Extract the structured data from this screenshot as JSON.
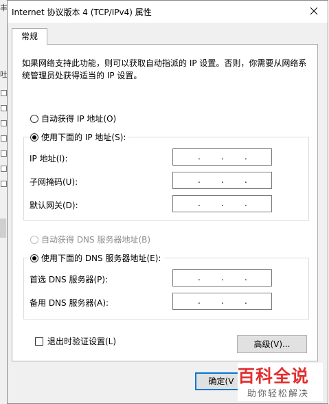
{
  "background": {
    "glyphs": [
      "丰",
      "吐"
    ]
  },
  "dialog": {
    "title": "Internet 协议版本 4 (TCP/IPv4) 属性",
    "tab": "常规",
    "description": "如果网络支持此功能，则可以获取自动指派的 IP 设置。否则，你需要从网络系统管理员处获得适当的 IP 设置。",
    "ip_auto": {
      "label": "自动获得 IP 地址(O)",
      "checked": false
    },
    "ip_manual": {
      "label": "使用下面的 IP 地址(S):",
      "checked": true
    },
    "ip_fields": [
      {
        "label": "IP 地址(I):"
      },
      {
        "label": "子网掩码(U):"
      },
      {
        "label": "默认网关(D):"
      }
    ],
    "dns_auto": {
      "label": "自动获得 DNS 服务器地址(B)",
      "checked": false,
      "disabled": true
    },
    "dns_manual": {
      "label": "使用下面的 DNS 服务器地址(E):",
      "checked": true
    },
    "dns_fields": [
      {
        "label": "首选 DNS 服务器(P):"
      },
      {
        "label": "备用 DNS 服务器(A):"
      }
    ],
    "ip_separator": ".",
    "validate_label": "退出时验证设置(L)",
    "advanced_label": "高级(V)...",
    "ok_label": "确定(V"
  },
  "watermark": {
    "logo": "百科全说",
    "subtitle": "助你轻松解决"
  },
  "colors": {
    "accent": "#0078d7",
    "watermark": "#e32e2e"
  }
}
